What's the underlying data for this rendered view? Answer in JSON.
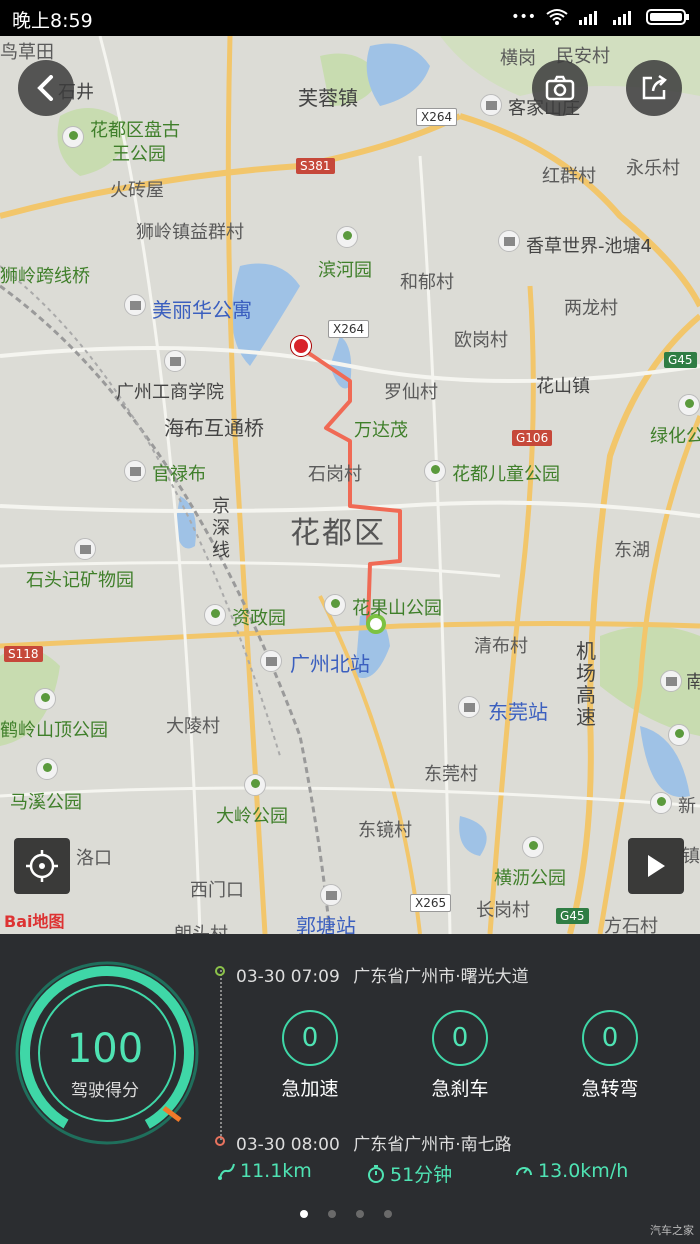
{
  "status_bar": {
    "time": "晚上8:59"
  },
  "map": {
    "district": "花都区",
    "labels": {
      "l_caotian": "鸟草田",
      "l_shijing": "石井",
      "l_furong": "芙蓉镇",
      "l_henggang": "横岗",
      "l_minan": "民安村",
      "l_panshi": "花都区盘古",
      "l_panshi2": "王公园",
      "l_hakka": "客家山庄",
      "l_huozhuan": "火砖屋",
      "l_hongqun": "红群村",
      "l_yongle": "永乐村",
      "l_yiqun": "狮岭镇益群村",
      "l_binhe": "滨河园",
      "l_xiangcao": "香草世界-池塘4",
      "l_kuaxian": "狮岭跨线桥",
      "l_hezhou": "和郁村",
      "l_lianglong": "两龙村",
      "l_meili": "美丽华公寓",
      "l_ougang": "欧岗村",
      "l_gongshang": "广州工商学院",
      "l_luoxian": "罗仙村",
      "l_huashan": "花山镇",
      "l_haibu": "海布互通桥",
      "l_wanda": "万达茂",
      "l_lvhua": "绿化公",
      "l_guanlu": "官禄布",
      "l_shigang": "石岗村",
      "l_ertong": "花都儿童公园",
      "l_jingshen": "京深线",
      "l_donghu": "东湖",
      "l_shitou": "石头记矿物园",
      "l_zizheng": "资政园",
      "l_huaguo": "花果山公园",
      "l_guangbei": "广州北站",
      "l_qingbu": "清布村",
      "l_jichang": "机场高速",
      "l_nan": "南",
      "l_dongguan_st": "东莞站",
      "l_heling": "鹤岭山顶公园",
      "l_daling": "大陵村",
      "l_dongguan_v": "东莞村",
      "l_maxi": "马溪公园",
      "l_dalinggy": "大岭公园",
      "l_xin": "新",
      "l_dongjing": "东镜村",
      "l_luokou": "洛口",
      "l_hengli": "横沥公园",
      "l_ximen": "西门口",
      "l_guotang": "郭塘站",
      "l_changgang": "长岗村",
      "l_langtou": "朗头村",
      "l_fangshi": "方石村",
      "l_zhen": "镇"
    },
    "roads": {
      "x264a": "X264",
      "s381": "S381",
      "x264b": "X264",
      "g45a": "G45",
      "g106": "G106",
      "s118": "S118",
      "x265": "X265",
      "g45b": "G45"
    },
    "logo": "Bai地图",
    "colors": {
      "route": "#f06a55",
      "start_dot": "#7cc242",
      "end_dot": "#d8232a"
    }
  },
  "controls": {
    "back": "back-icon",
    "camera": "camera-icon",
    "share": "share-icon",
    "locate": "locate-icon",
    "play": "play-icon"
  },
  "trip": {
    "score": "100",
    "score_label": "驾驶得分",
    "start": {
      "time": "03-30 07:09",
      "place": "广东省广州市·曙光大道"
    },
    "end": {
      "time": "03-30 08:00",
      "place": "广东省广州市·南七路"
    },
    "events": [
      {
        "count": "0",
        "label": "急加速"
      },
      {
        "count": "0",
        "label": "急刹车"
      },
      {
        "count": "0",
        "label": "急转弯"
      }
    ],
    "distance": "11.1km",
    "duration": "51分钟",
    "avg_speed": "13.0km/h"
  },
  "pager": {
    "total": 4,
    "active": 0
  },
  "watermark": "汽车之家"
}
